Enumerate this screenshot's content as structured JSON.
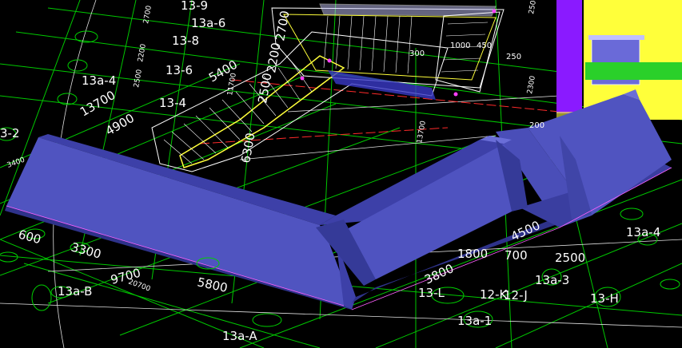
{
  "viewport_title": "",
  "grid_labels": {
    "g13_9": "13-9",
    "g13a_6": "13a-6",
    "g13_8": "13-8",
    "g13_6": "13-6",
    "g13a_4_left": "13a-4",
    "g13_4": "13-4",
    "g13_2": "3-2",
    "g13a_b": "13a-B",
    "g13a_a": "13a-A",
    "g13_l": "13-L",
    "g12_k": "12-K",
    "g12_j": "12-J",
    "g13a_3": "13a-3",
    "g13a_1": "13a-1",
    "g13_h": "13-H",
    "g13a_4_right": "13a-4"
  },
  "dimensions": {
    "d5400": "5400",
    "d2500": "2500",
    "d2200": "2200",
    "d2700": "2700",
    "d13700": "13700",
    "d4900": "4900",
    "d6300": "6300",
    "d600": "600",
    "d3300": "3300",
    "d9700": "9700",
    "d5800": "5800",
    "d3800": "3800",
    "d1800": "1800",
    "d700": "700",
    "d4500": "4500",
    "d2500b": "2500",
    "d300": "300",
    "d1000": "1000",
    "d450": "450",
    "d250": "250",
    "d200": "200"
  },
  "colors": {
    "background": "#000000",
    "grid_green": "#00d000",
    "beam_blue": "#4a4fb8",
    "beam_dark": "#2e328a",
    "wall_yellow": "#ffff3a",
    "wall_purple": "#8a1aff",
    "wall_green": "#2ad02a"
  }
}
